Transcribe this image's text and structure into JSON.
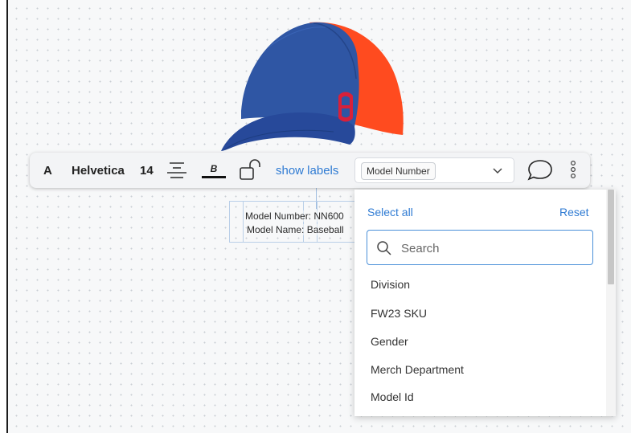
{
  "toolbar": {
    "text_tool": "A",
    "font_name": "Helvetica",
    "font_size": "14",
    "bold_label": "B",
    "show_labels": "show labels",
    "field_select_value": "Model Number"
  },
  "canvas_labels": {
    "line1": "Model Number: NN600",
    "line2": "Model Name: Baseball"
  },
  "dropdown": {
    "select_all": "Select all",
    "reset": "Reset",
    "search_placeholder": "Search",
    "items": [
      "Division",
      "FW23 SKU",
      "Gender",
      "Merch Department",
      "Model Id"
    ]
  },
  "colors": {
    "accent": "#2f7bd3",
    "cap_blue": "#2f56a4",
    "cap_red": "#ff4b1f",
    "logo_red": "#d8203a"
  },
  "icons": [
    "align-center-icon",
    "text-color-icon",
    "unlock-icon",
    "chevron-down-icon",
    "comment-icon",
    "more-vertical-icon",
    "search-icon"
  ]
}
